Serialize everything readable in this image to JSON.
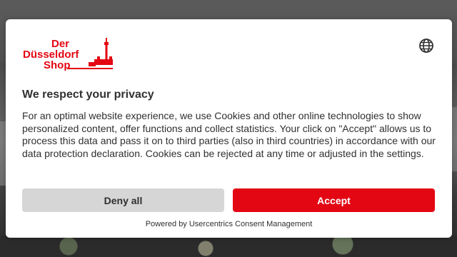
{
  "brand": {
    "logo_line1": "Der",
    "logo_line2": "Düsseldorf",
    "logo_line3": "Shop",
    "color": "#e30613"
  },
  "header": {
    "language_icon": "globe-icon"
  },
  "consent": {
    "title": "We respect your privacy",
    "text": "For an optimal website experience, we use Cookies and other online technologies to show personalized content, offer functions and collect statistics. Your click on \"Accept\" allows us to process this data and pass it on to third parties (also in third countries) in accordance with our data protection declaration. Cookies can be rejected at any time or adjusted in the settings.",
    "deny_label": "Deny all",
    "accept_label": "Accept",
    "powered_by": "Powered by Usercentrics Consent Management"
  },
  "colors": {
    "accent": "#e30613",
    "deny_bg": "#d6d6d6",
    "text": "#303030"
  }
}
